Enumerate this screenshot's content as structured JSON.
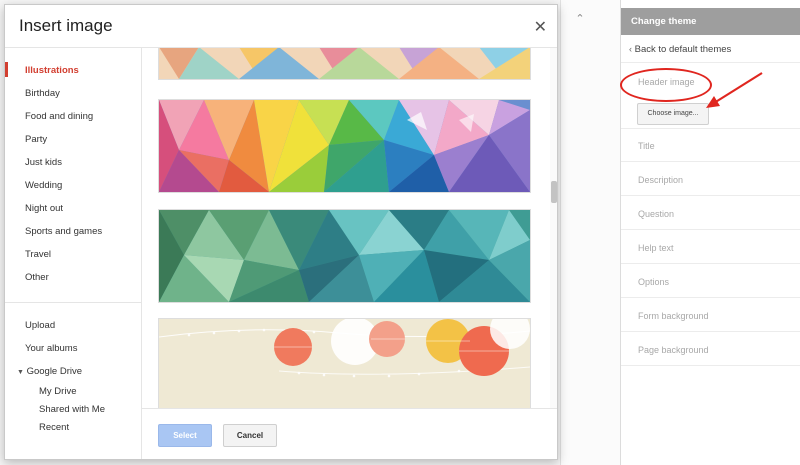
{
  "dialog": {
    "title": "Insert image",
    "close_icon": "close-icon",
    "categories": [
      {
        "label": "Illustrations",
        "active": true
      },
      {
        "label": "Birthday"
      },
      {
        "label": "Food and dining"
      },
      {
        "label": "Party"
      },
      {
        "label": "Just kids"
      },
      {
        "label": "Wedding"
      },
      {
        "label": "Night out"
      },
      {
        "label": "Sports and games"
      },
      {
        "label": "Travel"
      },
      {
        "label": "Other"
      }
    ],
    "sources": [
      {
        "label": "Upload"
      },
      {
        "label": "Your albums"
      },
      {
        "label": "Google Drive",
        "expanded": true
      },
      {
        "label": "My Drive"
      },
      {
        "label": "Shared with Me"
      },
      {
        "label": "Recent"
      }
    ],
    "select_label": "Select",
    "cancel_label": "Cancel"
  },
  "theme_panel": {
    "title": "Change theme",
    "back_link": "Back to default themes",
    "header_image_label": "Header image",
    "choose_image_label": "Choose image...",
    "fields": [
      "Title",
      "Description",
      "Question",
      "Help text",
      "Options",
      "Form background",
      "Page background"
    ]
  },
  "colors": {
    "accent_red": "#d23f31",
    "select_button": "#a9c6f3",
    "panel_header": "#9e9e9e",
    "annotation": "#e0261f"
  }
}
